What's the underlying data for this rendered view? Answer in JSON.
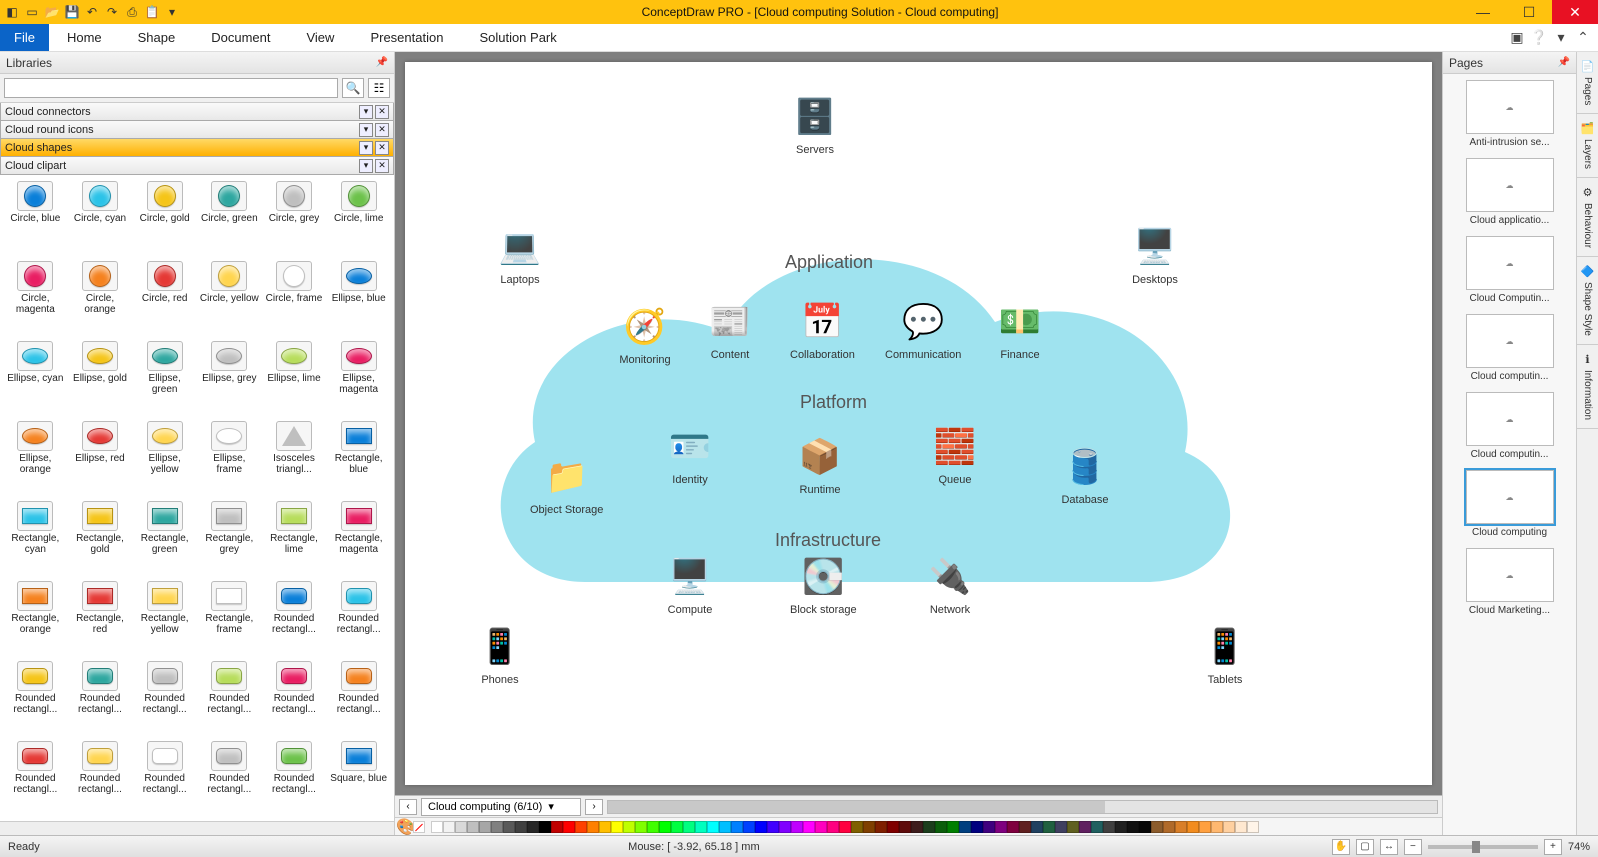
{
  "app": {
    "title": "ConceptDraw PRO - [Cloud computing Solution - Cloud computing]",
    "qat_icons": [
      "app-icon",
      "new-icon",
      "open-icon",
      "save-icon",
      "undo-icon",
      "redo-icon",
      "print-icon",
      "paste-icon",
      "dropdown-icon"
    ]
  },
  "menu": {
    "file": "File",
    "items": [
      "Home",
      "Shape",
      "Document",
      "View",
      "Presentation",
      "Solution Park"
    ],
    "right_icons": [
      "window-icon",
      "help-icon",
      "dropdown-icon",
      "collapse-icon"
    ]
  },
  "leftpanel": {
    "title": "Libraries",
    "search_placeholder": "",
    "groups": [
      {
        "label": "Cloud connectors",
        "selected": false
      },
      {
        "label": "Cloud round icons",
        "selected": false
      },
      {
        "label": "Cloud shapes",
        "selected": true
      },
      {
        "label": "Cloud clipart",
        "selected": false
      }
    ],
    "shapes": [
      {
        "label": "Circle, blue",
        "shape": "circle",
        "color": "#0a7fd9"
      },
      {
        "label": "Circle, cyan",
        "shape": "circle",
        "color": "#2bc3e8"
      },
      {
        "label": "Circle, gold",
        "shape": "circle",
        "color": "#f5c518"
      },
      {
        "label": "Circle, green",
        "shape": "circle",
        "color": "#2ea7a0"
      },
      {
        "label": "Circle, grey",
        "shape": "circle",
        "color": "#bfbfbf"
      },
      {
        "label": "Circle, lime",
        "shape": "circle",
        "color": "#6cc24a"
      },
      {
        "label": "Circle, magenta",
        "shape": "circle",
        "color": "#e91e63"
      },
      {
        "label": "Circle, orange",
        "shape": "circle",
        "color": "#f5821f"
      },
      {
        "label": "Circle, red",
        "shape": "circle",
        "color": "#e53935"
      },
      {
        "label": "Circle, yellow",
        "shape": "circle",
        "color": "#ffd54f"
      },
      {
        "label": "Circle, frame",
        "shape": "circle",
        "color": "#ffffff"
      },
      {
        "label": "Ellipse, blue",
        "shape": "ellipse",
        "color": "#0a7fd9"
      },
      {
        "label": "Ellipse, cyan",
        "shape": "ellipse",
        "color": "#2bc3e8"
      },
      {
        "label": "Ellipse, gold",
        "shape": "ellipse",
        "color": "#f5c518"
      },
      {
        "label": "Ellipse, green",
        "shape": "ellipse",
        "color": "#2ea7a0"
      },
      {
        "label": "Ellipse, grey",
        "shape": "ellipse",
        "color": "#bfbfbf"
      },
      {
        "label": "Ellipse, lime",
        "shape": "ellipse",
        "color": "#b7dd5b"
      },
      {
        "label": "Ellipse, magenta",
        "shape": "ellipse",
        "color": "#e91e63"
      },
      {
        "label": "Ellipse, orange",
        "shape": "ellipse",
        "color": "#f5821f"
      },
      {
        "label": "Ellipse, red",
        "shape": "ellipse",
        "color": "#e53935"
      },
      {
        "label": "Ellipse, yellow",
        "shape": "ellipse",
        "color": "#ffd54f"
      },
      {
        "label": "Ellipse, frame",
        "shape": "ellipse",
        "color": "#ffffff"
      },
      {
        "label": "Isosceles triangl...",
        "shape": "triangle",
        "color": "#bfbfbf"
      },
      {
        "label": "Rectangle, blue",
        "shape": "rect",
        "color": "#0a7fd9"
      },
      {
        "label": "Rectangle, cyan",
        "shape": "rect",
        "color": "#2bc3e8"
      },
      {
        "label": "Rectangle, gold",
        "shape": "rect",
        "color": "#f5c518"
      },
      {
        "label": "Rectangle, green",
        "shape": "rect",
        "color": "#2ea7a0"
      },
      {
        "label": "Rectangle, grey",
        "shape": "rect",
        "color": "#bfbfbf"
      },
      {
        "label": "Rectangle, lime",
        "shape": "rect",
        "color": "#b7dd5b"
      },
      {
        "label": "Rectangle, magenta",
        "shape": "rect",
        "color": "#e91e63"
      },
      {
        "label": "Rectangle, orange",
        "shape": "rect",
        "color": "#f5821f"
      },
      {
        "label": "Rectangle, red",
        "shape": "rect",
        "color": "#e53935"
      },
      {
        "label": "Rectangle, yellow",
        "shape": "rect",
        "color": "#ffd54f"
      },
      {
        "label": "Rectangle, frame",
        "shape": "rect",
        "color": "#ffffff"
      },
      {
        "label": "Rounded rectangl...",
        "shape": "rrect",
        "color": "#0a7fd9"
      },
      {
        "label": "Rounded rectangl...",
        "shape": "rrect",
        "color": "#2bc3e8"
      },
      {
        "label": "Rounded rectangl...",
        "shape": "rrect",
        "color": "#f5c518"
      },
      {
        "label": "Rounded rectangl...",
        "shape": "rrect",
        "color": "#2ea7a0"
      },
      {
        "label": "Rounded rectangl...",
        "shape": "rrect",
        "color": "#bfbfbf"
      },
      {
        "label": "Rounded rectangl...",
        "shape": "rrect",
        "color": "#b7dd5b"
      },
      {
        "label": "Rounded rectangl...",
        "shape": "rrect",
        "color": "#e91e63"
      },
      {
        "label": "Rounded rectangl...",
        "shape": "rrect",
        "color": "#f5821f"
      },
      {
        "label": "Rounded rectangl...",
        "shape": "rrect",
        "color": "#e53935"
      },
      {
        "label": "Rounded rectangl...",
        "shape": "rrect",
        "color": "#ffd54f"
      },
      {
        "label": "Rounded rectangl...",
        "shape": "rrect",
        "color": "#ffffff"
      },
      {
        "label": "Rounded rectangl...",
        "shape": "rrect",
        "color": "#c0c0c0"
      },
      {
        "label": "Rounded rectangl...",
        "shape": "rrect",
        "color": "#6cc24a"
      },
      {
        "label": "Square, blue",
        "shape": "rect",
        "color": "#0a7fd9"
      }
    ]
  },
  "diagram": {
    "sections": {
      "app": "Application",
      "plat": "Platform",
      "infra": "Infrastructure"
    },
    "nodes": {
      "servers": {
        "label": "Servers",
        "color": "#f5a623"
      },
      "laptops": {
        "label": "Laptops",
        "color": "#00a9e0"
      },
      "desktops": {
        "label": "Desktops",
        "color": "#00a9e0"
      },
      "monitoring": {
        "label": "Monitoring",
        "color": "#0a7fd9"
      },
      "content": {
        "label": "Content",
        "color": "#9aa0a6"
      },
      "collab": {
        "label": "Collaboration",
        "color": "#f5a623"
      },
      "comm": {
        "label": "Communication",
        "color": "#0a7fd9"
      },
      "finance": {
        "label": "Finance",
        "color": "#2ea77f"
      },
      "identity": {
        "label": "Identity",
        "color": "#0a7fd9"
      },
      "objstor": {
        "label": "Object Storage",
        "color": "#f5821f"
      },
      "runtime": {
        "label": "Runtime",
        "color": "#0a7fd9"
      },
      "queue": {
        "label": "Queue",
        "color": "#0a7fd9"
      },
      "database": {
        "label": "Database",
        "color": "#0a7fd9"
      },
      "compute": {
        "label": "Compute",
        "color": "#0a7fd9"
      },
      "blockstor": {
        "label": "Block storage",
        "color": "#555555"
      },
      "network": {
        "label": "Network",
        "color": "#0a7fd9"
      },
      "phones": {
        "label": "Phones",
        "color": "#c2185b"
      },
      "tablets": {
        "label": "Tablets",
        "color": "#00a9e0"
      }
    }
  },
  "tabs": {
    "current": "Cloud computing (6/10)"
  },
  "palette_colors": [
    "#ffffff",
    "#f2f2f2",
    "#d9d9d9",
    "#bfbfbf",
    "#a6a6a6",
    "#808080",
    "#595959",
    "#404040",
    "#262626",
    "#000000",
    "#c00000",
    "#ff0000",
    "#ff4000",
    "#ff8000",
    "#ffbf00",
    "#ffff00",
    "#bfff00",
    "#80ff00",
    "#40ff00",
    "#00ff00",
    "#00ff40",
    "#00ff80",
    "#00ffbf",
    "#00ffff",
    "#00bfff",
    "#0080ff",
    "#0040ff",
    "#0000ff",
    "#4000ff",
    "#8000ff",
    "#bf00ff",
    "#ff00ff",
    "#ff00bf",
    "#ff0080",
    "#ff0040",
    "#7f6000",
    "#7f3f00",
    "#7f1f00",
    "#7f0000",
    "#5e0b0b",
    "#3d1c1c",
    "#1c3d1c",
    "#0b5e0b",
    "#007f00",
    "#003f7f",
    "#00007f",
    "#3f007f",
    "#7f007f",
    "#7f003f",
    "#602020",
    "#204060",
    "#206040",
    "#404060",
    "#606020",
    "#602060",
    "#206060",
    "#404040",
    "#202020",
    "#101010",
    "#080808",
    "#8c5c2c",
    "#b06a2a",
    "#d97f29",
    "#f28c1f",
    "#ffa040",
    "#ffb870",
    "#ffd0a0",
    "#ffe8d0",
    "#fff4e8"
  ],
  "rightpanel": {
    "title": "Pages",
    "thumbs": [
      {
        "label": "Anti-intrusion se..."
      },
      {
        "label": "Cloud applicatio..."
      },
      {
        "label": "Cloud Computin..."
      },
      {
        "label": "Cloud computin..."
      },
      {
        "label": "Cloud computin..."
      },
      {
        "label": "Cloud computing",
        "selected": true
      },
      {
        "label": "Cloud Marketing..."
      }
    ],
    "sidetabs": [
      "Pages",
      "Layers",
      "Behaviour",
      "Shape Style",
      "Information"
    ]
  },
  "status": {
    "ready": "Ready",
    "mouse": "Mouse: [ -3.92, 65.18 ] mm",
    "zoom": "74%"
  }
}
